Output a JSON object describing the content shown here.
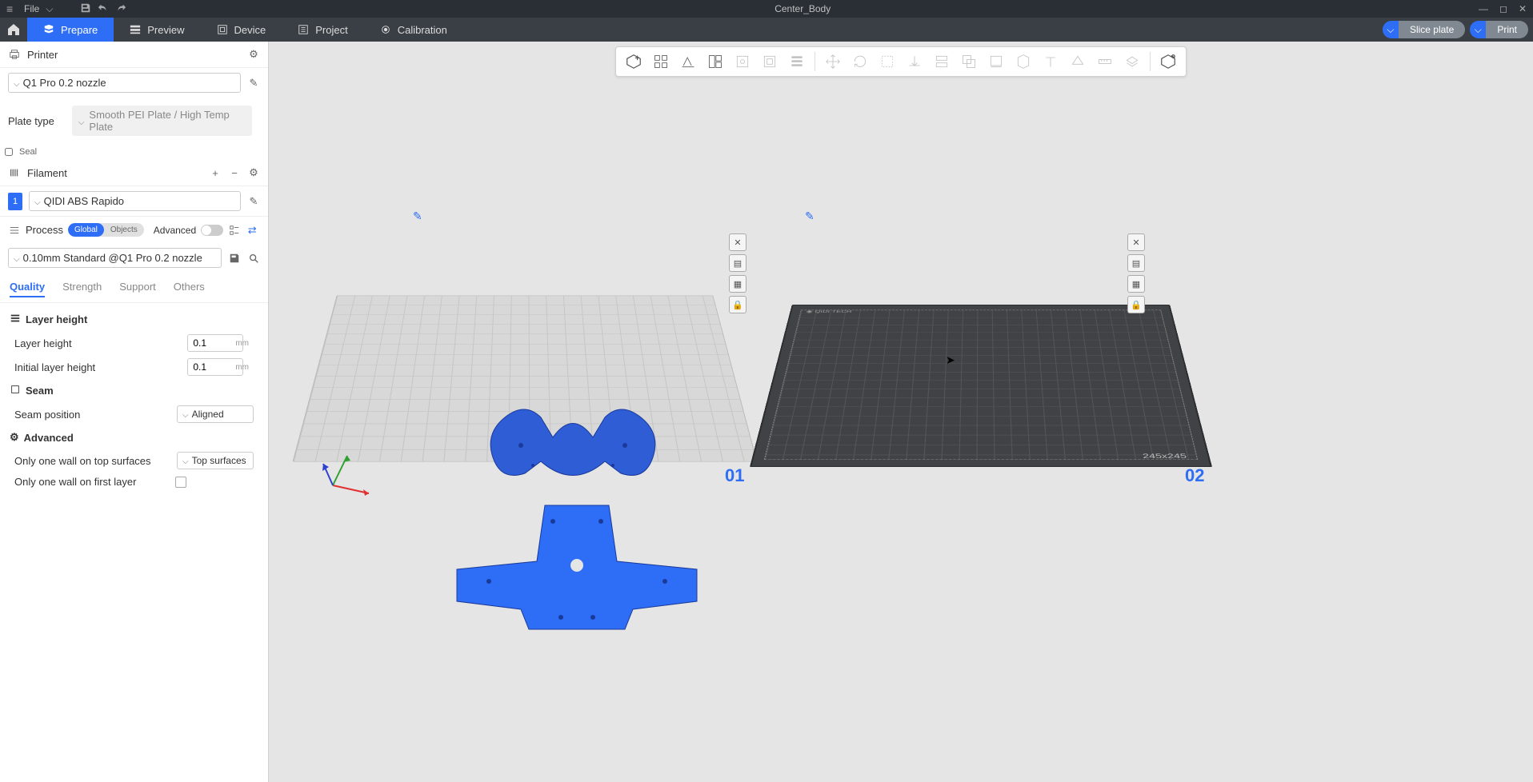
{
  "titlebar": {
    "menu": "File",
    "title": "Center_Body"
  },
  "nav": {
    "prepare": "Prepare",
    "preview": "Preview",
    "device": "Device",
    "project": "Project",
    "calibration": "Calibration",
    "slice": "Slice plate",
    "print": "Print"
  },
  "sidebar": {
    "printer_label": "Printer",
    "printer_sel": "Q1 Pro 0.2 nozzle",
    "plate_type_label": "Plate type",
    "plate_type_sel": "Smooth PEI Plate / High Temp Plate",
    "seal_label": "Seal",
    "filament_label": "Filament",
    "filament_num": "1",
    "filament_sel": "QIDI ABS Rapido",
    "process_label": "Process",
    "chip_global": "Global",
    "chip_objects": "Objects",
    "advanced_label": "Advanced",
    "process_sel": "0.10mm Standard @Q1 Pro 0.2 nozzle",
    "tabs": {
      "quality": "Quality",
      "strength": "Strength",
      "support": "Support",
      "others": "Others"
    },
    "sections": {
      "layer_height": {
        "title": "Layer height",
        "layer_height_label": "Layer height",
        "layer_height_val": "0.1",
        "initial_label": "Initial layer height",
        "initial_val": "0.1",
        "unit": "mm"
      },
      "seam": {
        "title": "Seam",
        "position_label": "Seam position",
        "position_val": "Aligned"
      },
      "advanced": {
        "title": "Advanced",
        "one_wall_top_label": "Only one wall on top surfaces",
        "one_wall_top_val": "Top surfaces",
        "one_wall_first_label": "Only one wall on first layer"
      }
    }
  },
  "viewport": {
    "plate1_num": "01",
    "plate2_num": "02",
    "plate2_size": "245x245",
    "plate2_brand": "QIDI TECH"
  }
}
